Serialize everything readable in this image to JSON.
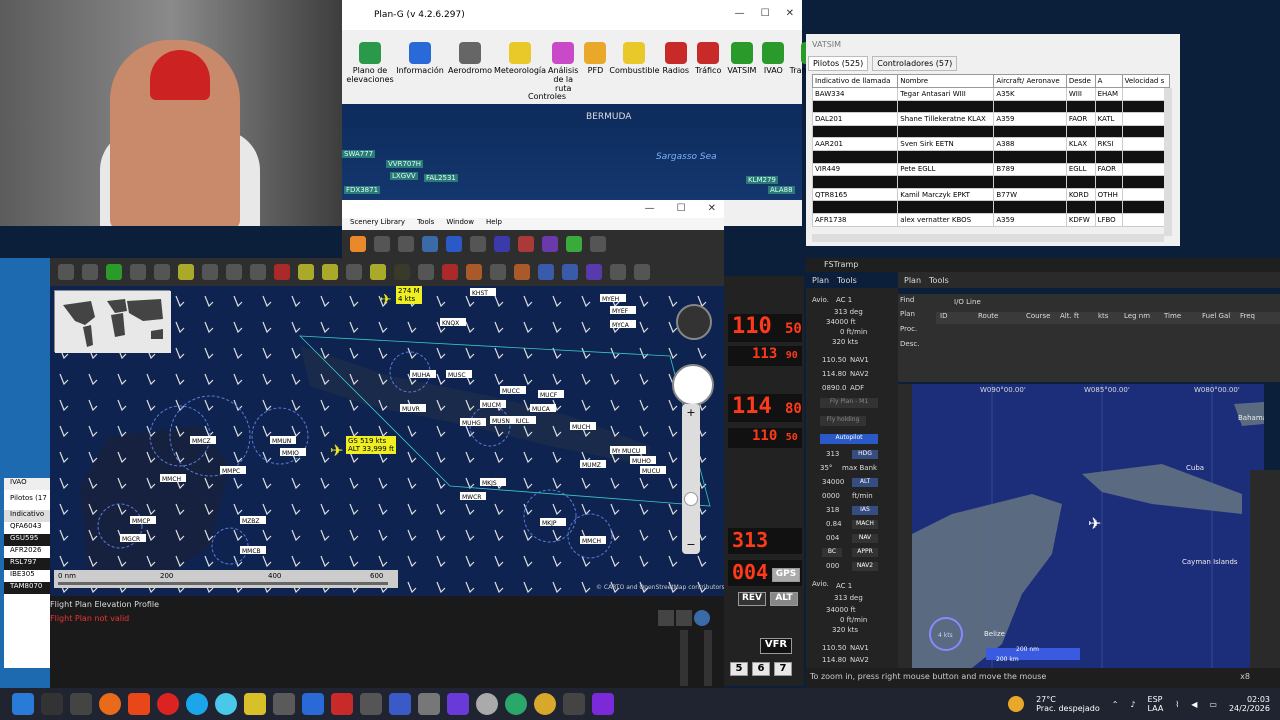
{
  "plan_g": {
    "title": "Plan-G (v 4.2.6.297)",
    "toolbar": [
      {
        "label": "Plano de elevaciones",
        "icon": "elevation-plan-icon"
      },
      {
        "label": "Información",
        "icon": "info-icon"
      },
      {
        "label": "Aerodromo",
        "icon": "aerodrome-icon"
      },
      {
        "label": "Meteorología",
        "icon": "weather-icon"
      },
      {
        "label": "Análisis de la ruta",
        "icon": "route-analysis-icon"
      },
      {
        "label": "PFD",
        "icon": "pfd-icon"
      },
      {
        "label": "Combustible",
        "icon": "fuel-icon"
      },
      {
        "label": "Radios",
        "icon": "radios-icon"
      },
      {
        "label": "Tráfico",
        "icon": "traffic-icon"
      },
      {
        "label": "VATSIM",
        "icon": "vatsim-icon"
      },
      {
        "label": "IVAO",
        "icon": "ivao-icon"
      },
      {
        "label": "Transmitter",
        "icon": "transmitter-icon"
      }
    ],
    "ribbon_group": "Controles",
    "map_labels": {
      "bermuda": "BERMUDA",
      "sargasso": "Sargasso Sea"
    },
    "top_tags": [
      "VVR707H",
      "LXGVV",
      "FAL2531",
      "KLM279",
      "FDX3871",
      "SWA777",
      "ALA88"
    ]
  },
  "scenery": {
    "menu": [
      "Scenery Library",
      "Tools",
      "Window",
      "Help"
    ]
  },
  "main_map": {
    "aircraft_label": "274 M\n4 kts",
    "gs_label": "GS 519 kts",
    "alt_label": "ALT 33,999 ft",
    "airports": [
      "KHST",
      "KNQX",
      "MYEH",
      "MYEF",
      "MYCA",
      "MUHA",
      "MUSC",
      "MUCC",
      "MUCF",
      "MUCM",
      "MUCA",
      "MUCL",
      "MUHG",
      "MUSN",
      "MUVR",
      "MYGW",
      "MUCH",
      "MUCU",
      "MUHO",
      "MUMZ",
      "MUCU",
      "MMCZ",
      "MMUN",
      "MMIO",
      "MMPC",
      "MMCH",
      "MZBZ",
      "MMCB",
      "MMCP",
      "MGCR",
      "MWCR",
      "MKJS",
      "MKJP",
      "MMCH"
    ],
    "scale_labels": [
      "0 nm",
      "200",
      "400",
      "600"
    ],
    "copyright": "© CARTO and OpenStreetMap contributors"
  },
  "elevation_profile": {
    "title": "Flight Plan Elevation Profile",
    "status": "Flight Plan not valid"
  },
  "ivao_panel": {
    "title": "IVAO",
    "tab": "Pilotos (17",
    "header": "Indicativo",
    "rows": [
      "QFA6043",
      "GSU595",
      "AFR2026",
      "RSL797",
      "IBE305",
      "TAM8070"
    ]
  },
  "vatsim": {
    "window_title": "VATSIM",
    "tabs": [
      "Pilotos (525)",
      "Controladores (57)"
    ],
    "columns": [
      "Indicativo de llamada",
      "Nombre",
      "Aircraft/ Aeronave",
      "Desde",
      "A",
      "Velocidad s"
    ],
    "rows": [
      {
        "callsign": "BAW334",
        "name": "Tegar Antasari WIII",
        "aircraft": "A35K",
        "from": "WIII",
        "to": "EHAM",
        "dark": false
      },
      {
        "callsign": "",
        "name": "",
        "aircraft": "",
        "from": "",
        "to": "",
        "dark": true
      },
      {
        "callsign": "DAL201",
        "name": "Shane Tillekeratne KLAX",
        "aircraft": "A359",
        "from": "FAOR",
        "to": "KATL",
        "dark": false
      },
      {
        "callsign": "",
        "name": "",
        "aircraft": "",
        "from": "",
        "to": "",
        "dark": true
      },
      {
        "callsign": "AAR201",
        "name": "Sven Sirk EETN",
        "aircraft": "A388",
        "from": "KLAX",
        "to": "RKSI",
        "dark": false
      },
      {
        "callsign": "",
        "name": "",
        "aircraft": "",
        "from": "",
        "to": "",
        "dark": true
      },
      {
        "callsign": "VIR449",
        "name": "Pete EGLL",
        "aircraft": "B789",
        "from": "EGLL",
        "to": "FAOR",
        "dark": false
      },
      {
        "callsign": "",
        "name": "",
        "aircraft": "",
        "from": "",
        "to": "",
        "dark": true
      },
      {
        "callsign": "QTR8165",
        "name": "Kamil Marczyk EPKT",
        "aircraft": "B77W",
        "from": "KORD",
        "to": "OTHH",
        "dark": false
      },
      {
        "callsign": "",
        "name": "",
        "aircraft": "",
        "from": "",
        "to": "",
        "dark": true
      },
      {
        "callsign": "AFR1738",
        "name": "alex vernatter KBOS",
        "aircraft": "A359",
        "from": "KDFW",
        "to": "LFBO",
        "dark": false
      }
    ]
  },
  "radios": {
    "com1_active": "110",
    "com1_active_dec": "50",
    "com1_standby": "113",
    "com1_standby_dec": "90",
    "com2_active": "114",
    "com2_active_dec": "80",
    "com2_standby": "110",
    "com2_standby_dec": "50",
    "xpdr_top": "313",
    "xpdr_bottom": "004",
    "gps": "GPS",
    "rev": "REV",
    "alt": "ALT",
    "vfr": "VFR",
    "nums": [
      "5",
      "6",
      "7"
    ]
  },
  "fstramp": {
    "title": "FSTramp",
    "left_menu": [
      "Plan",
      "Tools"
    ],
    "right_menu": [
      "Plan",
      "Tools"
    ],
    "ac1": {
      "label": "Avio.",
      "ac": "AC 1",
      "deg": "313 deg",
      "ft": "34000 ft",
      "ftmin": "0 ft/min",
      "kts": "320 kts",
      "nav1": "110.50",
      "nav2": "114.80",
      "adf": "0890.0",
      "nav1_label": "NAV1",
      "nav2_label": "NAV2",
      "adf_label": "ADF"
    },
    "autopilot": {
      "flyplan": "Fly Plan - M1",
      "flyholding": "Fly holding",
      "autopilot": "Autopilot",
      "hdg_val": "313",
      "hdg": "HDG",
      "bank": "35°",
      "bank_label": "max Bank",
      "alt_val": "34000",
      "alt": "ALT",
      "vs_val": "0000",
      "vs": "ft/min",
      "ias_val": "318",
      "ias": "IAS",
      "mach_val": "0.84",
      "mach": "MACH",
      "nav_val": "004",
      "nav": "NAV",
      "bc": "BC",
      "appr": "APPR",
      "nav2_val": "000",
      "nav2": "NAV2"
    },
    "ac1b": {
      "label": "Avio.",
      "ac": "AC 1",
      "deg": "313 deg",
      "ft": "34000 ft",
      "ftmin": "0 ft/min",
      "kts": "320 kts",
      "nav1": "110.50",
      "nav2": "114.80",
      "nav1_label": "NAV1",
      "nav2_label": "NAV2"
    },
    "find": "Find",
    "plan": "Plan",
    "proc": "Proc.",
    "desc": "Desc.",
    "tab_io": "I/O Line",
    "grid_cols": [
      "ID",
      "Route",
      "Course",
      "Alt. ft",
      "kts",
      "Leg nm",
      "Time",
      "Fuel Gal",
      "Freq"
    ],
    "map_labels": {
      "w090": "W090°00.00'",
      "w085": "W085°00.00'",
      "w080": "W080°00.00'",
      "cuba": "Cuba",
      "cayman": "Cayman Islands",
      "belize": "Belize",
      "bahamas": "Bahamas",
      "kts": "4 kts"
    },
    "scale": [
      "200 nm",
      "200 km"
    ],
    "status": "To zoom in, press right mouse button and move the mouse",
    "x8": "x8"
  },
  "taskbar": {
    "weather_temp": "27°C",
    "weather_desc": "Prac. despejado",
    "lang": "ESP",
    "lang2": "LAA",
    "time": "02:03",
    "date": "24/2/2026"
  }
}
